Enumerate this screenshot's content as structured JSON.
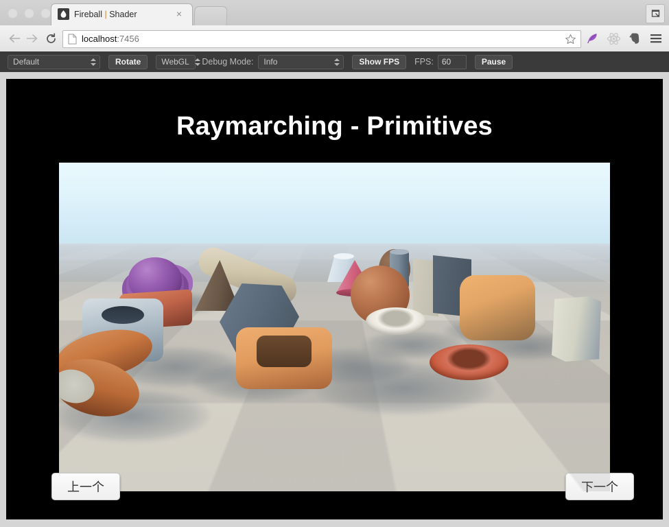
{
  "browser": {
    "tab": {
      "title_main": "Fireball",
      "title_sep": "|",
      "title_sub": "Shader",
      "favicon": "fireball-logo-icon",
      "close": "×"
    },
    "new_tab_label": "",
    "window_extra_icon": "window-capture-icon",
    "nav": {
      "back_icon": "arrow-left-icon",
      "forward_icon": "arrow-right-icon",
      "reload_icon": "reload-icon"
    },
    "omnibox": {
      "doc_icon": "page-document-icon",
      "host": "localhost",
      "port": ":7456",
      "star_icon": "bookmark-star-icon"
    },
    "extensions": [
      {
        "name": "feather-icon",
        "color": "#9b59c6"
      },
      {
        "name": "react-logo-icon",
        "color": "#bdbdbd"
      },
      {
        "name": "evernote-icon",
        "color": "#5a5a5a"
      },
      {
        "name": "menu-hamburger-icon",
        "color": "#4a4a4a"
      }
    ]
  },
  "toolbar": {
    "scene_select": {
      "value": "Default",
      "icon": "stepper-arrows-icon"
    },
    "rotate_button": "Rotate",
    "renderer_select": {
      "value": "WebGL",
      "icon": "stepper-arrows-icon"
    },
    "debug_mode_label": "Debug Mode:",
    "debug_select": {
      "value": "Info",
      "icon": "stepper-arrows-icon"
    },
    "show_fps_button": "Show FPS",
    "fps_label": "FPS:",
    "fps_value": "60",
    "pause_button": "Pause"
  },
  "page": {
    "title": "Raymarching - Primitives",
    "background": "#000000",
    "prev_button": "上一个",
    "next_button": "下一个"
  },
  "scene": {
    "name": "raymarching-primitives",
    "sky_top": "#e9f8fd",
    "sky_horizon": "#cae5f1",
    "ground": "#d4d0c6",
    "objects": [
      {
        "name": "twisted-torus-orange",
        "color": "#c8773f"
      },
      {
        "name": "box-frame-blue",
        "color": "#9fb2bd"
      },
      {
        "name": "displaced-sphere-purple",
        "color": "#8b4f9e"
      },
      {
        "name": "rounded-box-salmon",
        "color": "#c2654a"
      },
      {
        "name": "triangular-prism-dark",
        "color": "#6b5a4d"
      },
      {
        "name": "capsule-cream",
        "color": "#cbbda4"
      },
      {
        "name": "hexagonal-prism-slate",
        "color": "#59697a"
      },
      {
        "name": "rounded-square-torus-orange",
        "color": "#e09a5c"
      },
      {
        "name": "cone-cylinder-cap-light",
        "color": "#b9c6d0"
      },
      {
        "name": "cone-pink",
        "color": "#c9566e"
      },
      {
        "name": "sphere-brown",
        "color": "#b06a46"
      },
      {
        "name": "ellipsoid-dark-brown",
        "color": "#7a5a46"
      },
      {
        "name": "torus-white",
        "color": "#e6e4dc"
      },
      {
        "name": "cylinder-slate",
        "color": "#6d7d8c"
      },
      {
        "name": "plane-panel-cream",
        "color": "#c3c0b2"
      },
      {
        "name": "plane-panel-slate",
        "color": "#4e5a67"
      },
      {
        "name": "rounded-cube-orange",
        "color": "#e3a565"
      },
      {
        "name": "torus-orange",
        "color": "#c8593c"
      },
      {
        "name": "hex-cylinder-cream",
        "color": "#d7d8c8"
      }
    ]
  }
}
